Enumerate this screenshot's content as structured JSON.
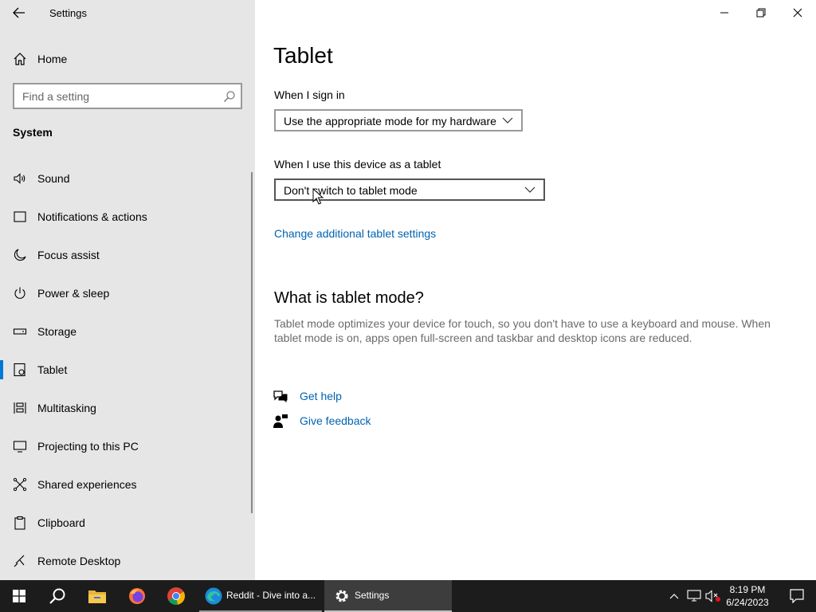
{
  "window": {
    "app_title": "Settings",
    "controls": [
      "minimize",
      "restore",
      "close"
    ]
  },
  "sidebar": {
    "home_label": "Home",
    "search": {
      "placeholder": "Find a setting",
      "value": ""
    },
    "section_heading": "System",
    "items": [
      {
        "label": "Sound",
        "icon": "speaker-icon",
        "selected": false
      },
      {
        "label": "Notifications & actions",
        "icon": "notifications-icon",
        "selected": false
      },
      {
        "label": "Focus assist",
        "icon": "moon-icon",
        "selected": false
      },
      {
        "label": "Power & sleep",
        "icon": "power-icon",
        "selected": false
      },
      {
        "label": "Storage",
        "icon": "storage-icon",
        "selected": false
      },
      {
        "label": "Tablet",
        "icon": "tablet-icon",
        "selected": true
      },
      {
        "label": "Multitasking",
        "icon": "multitasking-icon",
        "selected": false
      },
      {
        "label": "Projecting to this PC",
        "icon": "projecting-icon",
        "selected": false
      },
      {
        "label": "Shared experiences",
        "icon": "shared-experiences-icon",
        "selected": false
      },
      {
        "label": "Clipboard",
        "icon": "clipboard-icon",
        "selected": false
      },
      {
        "label": "Remote Desktop",
        "icon": "remote-desktop-icon",
        "selected": false
      }
    ]
  },
  "main": {
    "page_title": "Tablet",
    "sign_in": {
      "label": "When I sign in",
      "selected": "Use the appropriate mode for my hardware"
    },
    "tablet_use": {
      "label": "When I use this device as a tablet",
      "selected": "Don't switch to tablet mode"
    },
    "additional_link": "Change additional tablet settings",
    "what_heading": "What is tablet mode?",
    "what_description": "Tablet mode optimizes your device for touch, so you don't have to use a keyboard and mouse. When tablet mode is on, apps open full-screen and taskbar and desktop icons are reduced.",
    "get_help": "Get help",
    "give_feedback": "Give feedback"
  },
  "taskbar": {
    "apps": [
      {
        "label": "Reddit - Dive into a...",
        "icon": "edge-icon",
        "active": false
      },
      {
        "label": "Settings",
        "icon": "gear-icon",
        "active": true
      }
    ],
    "pinned": [
      "file-explorer-icon",
      "firefox-icon",
      "chrome-icon"
    ],
    "clock": {
      "time": "8:19 PM",
      "date": "6/24/2023"
    },
    "colors": {
      "accent": "#0078d7",
      "taskbar": "#1c1c1c",
      "link": "#0063b1"
    }
  }
}
